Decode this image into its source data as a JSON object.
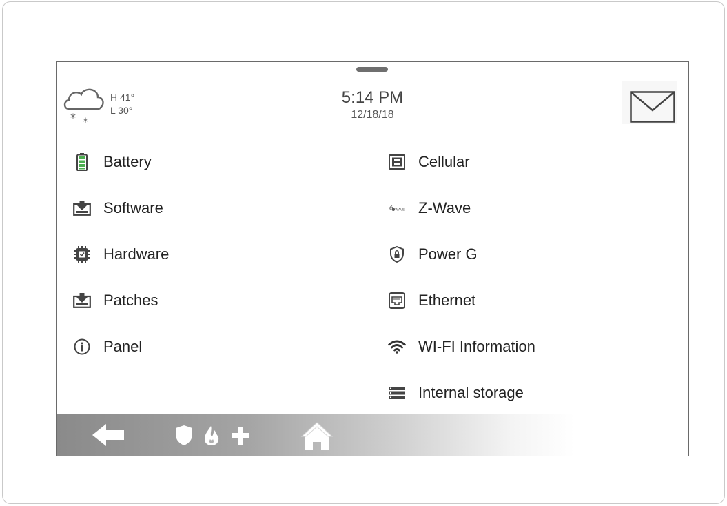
{
  "weather": {
    "high": "H 41°",
    "low": "L 30°",
    "icon": "cloud-snow-icon"
  },
  "clock": {
    "time": "5:14 PM",
    "date": "12/18/18"
  },
  "left_items": [
    {
      "label": "Battery",
      "icon": "battery-icon"
    },
    {
      "label": "Software",
      "icon": "download-box-icon"
    },
    {
      "label": "Hardware",
      "icon": "chip-icon"
    },
    {
      "label": "Patches",
      "icon": "download-box-icon"
    },
    {
      "label": "Panel",
      "icon": "info-icon"
    }
  ],
  "right_items": [
    {
      "label": "Cellular",
      "icon": "sim-icon"
    },
    {
      "label": "Z-Wave",
      "icon": "zwave-icon"
    },
    {
      "label": "Power G",
      "icon": "shield-lock-icon"
    },
    {
      "label": "Ethernet",
      "icon": "ethernet-icon"
    },
    {
      "label": "WI-FI Information",
      "icon": "wifi-icon"
    },
    {
      "label": "Internal storage",
      "icon": "storage-icon"
    }
  ],
  "bottom_bar": {
    "back": "back-arrow-icon",
    "security": "shield-icon",
    "fire": "fire-icon",
    "medical": "plus-icon",
    "home": "home-icon"
  },
  "colors": {
    "battery_green": "#4caf50",
    "icon_gray": "#4a4a4a"
  }
}
